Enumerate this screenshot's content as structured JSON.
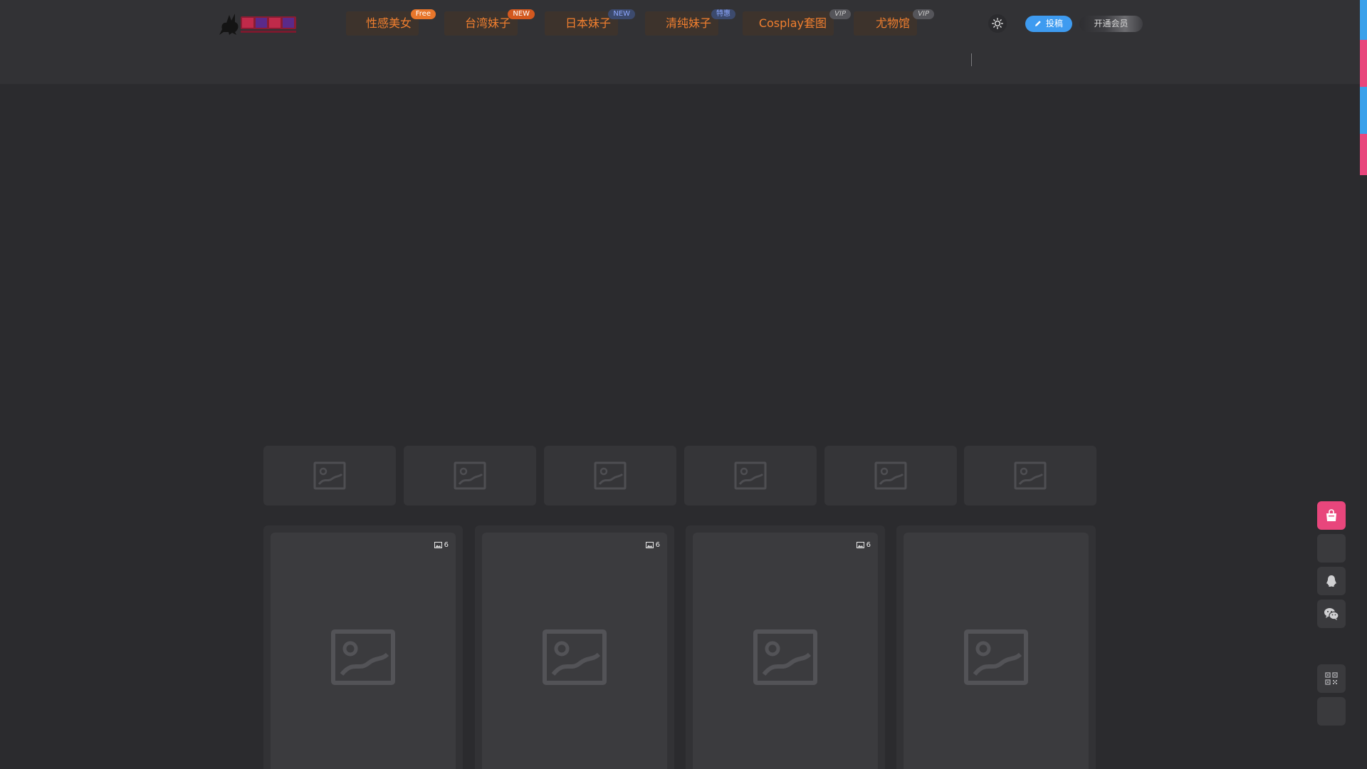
{
  "header": {
    "nav": [
      {
        "label": "性感美女",
        "badge": "Free"
      },
      {
        "label": "台湾妹子",
        "badge": "NEW"
      },
      {
        "label": "日本妹子",
        "badge": "NEW"
      },
      {
        "label": "清纯妹子",
        "badge": "特惠"
      },
      {
        "label": "Cosplay套图",
        "badge": "VIP"
      },
      {
        "label": "尤物馆",
        "badge": "VIP"
      }
    ],
    "submit_label": "投稿",
    "vip_label": "开通会员"
  },
  "cards": [
    {
      "count": "6"
    },
    {
      "count": "6"
    },
    {
      "count": "6"
    },
    {
      "count": ""
    }
  ],
  "colors": {
    "accent_orange": "#f17f2f",
    "accent_blue": "#3e9bf0",
    "accent_pink": "#e8467c",
    "background": "#2b2b2e",
    "header": "#323235"
  },
  "icons": {
    "theme": "sun-icon",
    "submit": "pencil-icon",
    "shop": "shopping-bag-icon",
    "qq": "qq-penguin-icon",
    "wechat": "wechat-icon",
    "qrcode": "qrcode-icon",
    "placeholder": "image-placeholder-icon"
  }
}
